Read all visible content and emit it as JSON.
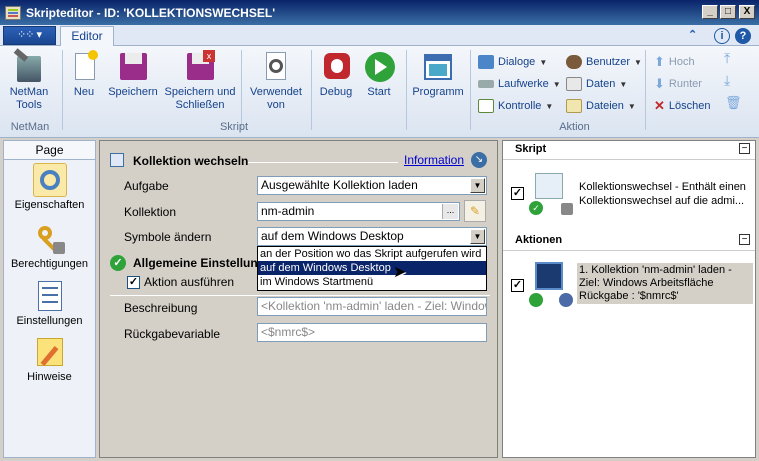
{
  "window": {
    "title": "Skripteditor - ID: 'KOLLEKTIONSWECHSEL'",
    "min": "_",
    "max": "□",
    "close": "X"
  },
  "ribbon_tabs": {
    "app_menu": "▾",
    "editor": "Editor",
    "help_info": "i",
    "help": "?"
  },
  "ribbon": {
    "groups": {
      "netman": "NetMan",
      "skript": "Skript",
      "aktion": "Aktion"
    },
    "netman_tools": "NetMan Tools",
    "neu": "Neu",
    "speichern": "Speichern",
    "speichern_schliessen": "Speichern und Schließen",
    "verwendet_von": "Verwendet von",
    "debug": "Debug",
    "start": "Start",
    "programm": "Programm",
    "dialoge": "Dialoge",
    "laufwerke": "Laufwerke",
    "kontrolle": "Kontrolle",
    "benutzer": "Benutzer",
    "daten": "Daten",
    "dateien": "Dateien",
    "hoch": "Hoch",
    "runter": "Runter",
    "loeschen": "Löschen"
  },
  "nav": {
    "header": "Page",
    "items": [
      "Eigenschaften",
      "Berechtigungen",
      "Einstellungen",
      "Hinweise"
    ]
  },
  "form": {
    "section_title": "Kollektion wechseln",
    "info_link": "Information",
    "aufgabe_label": "Aufgabe",
    "aufgabe_value": "Ausgewählte Kollektion laden",
    "kollektion_label": "Kollektion",
    "kollektion_value": "nm-admin",
    "browse": "...",
    "symbole_label": "Symbole ändern",
    "symbole_value": "auf dem Windows Desktop",
    "dropdown_options": [
      "an der Position wo das Skript aufgerufen wird",
      "auf dem Windows Desktop",
      "im Windows Startmenü"
    ],
    "allgemein_title": "Allgemeine Einstellungen",
    "allgemein_visible": "Allgemeine Einstellung",
    "aktion_ausfuehren": "Aktion ausführen",
    "beschreibung_label": "Beschreibung",
    "beschreibung_placeholder": "<Kollektion 'nm-admin' laden - Ziel: Windows A",
    "rueckgabe_label": "Rückgabevariable",
    "rueckgabe_placeholder": "<$nmrc$>"
  },
  "right": {
    "skript_header": "Skript",
    "skript_desc": "Kollektionswechsel - Enthält einen Kollektionswechsel auf die admi...",
    "aktionen_header": "Aktionen",
    "action_line1": "1. Kollektion 'nm-admin' laden - Ziel: Windows Arbeitsfläche",
    "action_line2": "Rückgabe : '$nmrc$'",
    "collapse": "−"
  },
  "colors": {
    "title_bar": "#0a246a",
    "selection": "#0a246a",
    "ribbon_text": "#15428b"
  }
}
